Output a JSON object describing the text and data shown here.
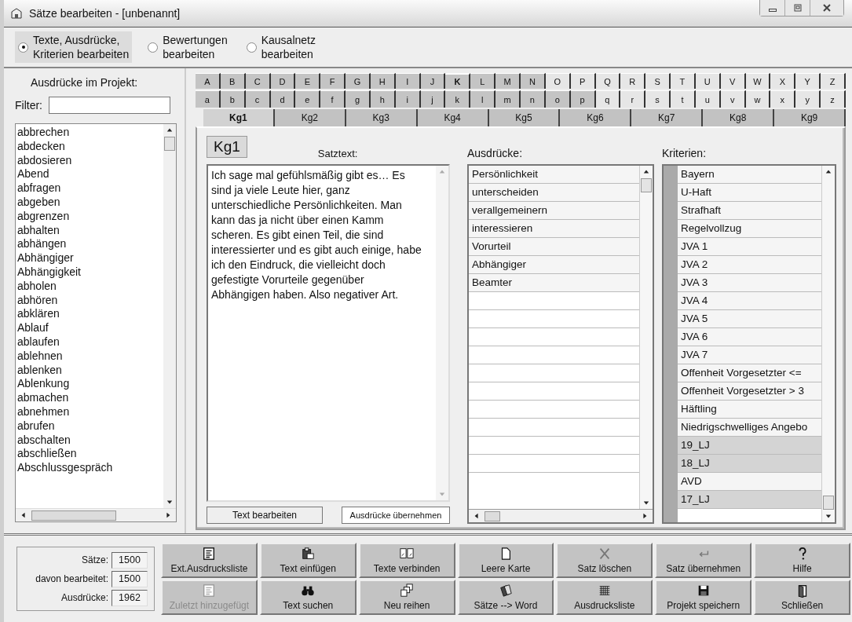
{
  "window": {
    "title": "Sätze bearbeiten - [unbenannt]"
  },
  "modes": [
    {
      "label": "Texte, Ausdrücke,\nKriterien bearbeiten",
      "selected": true
    },
    {
      "label": "Bewertungen\nbearbeiten",
      "selected": false
    },
    {
      "label": "Kausalnetz\nbearbeiten",
      "selected": false
    }
  ],
  "expressions_panel": {
    "title": "Ausdrücke im Projekt:",
    "filter_label": "Filter:",
    "items": [
      "abbrechen",
      "abdecken",
      "abdosieren",
      "Abend",
      "abfragen",
      "abgeben",
      "abgrenzen",
      "abhalten",
      "abhängen",
      "Abhängiger",
      "Abhängigkeit",
      "abholen",
      "abhören",
      "abklären",
      "Ablauf",
      "ablaufen",
      "ablehnen",
      "ablenken",
      "Ablenkung",
      "abmachen",
      "abnehmen",
      "abrufen",
      "abschalten",
      "abschließen",
      "Abschlussgespräch"
    ]
  },
  "letters_upper": [
    {
      "label": "A",
      "selected": false,
      "shaded": true
    },
    {
      "label": "B",
      "selected": false,
      "shaded": true
    },
    {
      "label": "C",
      "selected": false,
      "shaded": true
    },
    {
      "label": "D",
      "selected": false,
      "shaded": true
    },
    {
      "label": "E",
      "selected": false,
      "shaded": true
    },
    {
      "label": "F",
      "selected": false,
      "shaded": true
    },
    {
      "label": "G",
      "selected": false,
      "shaded": true
    },
    {
      "label": "H",
      "selected": false,
      "shaded": true
    },
    {
      "label": "I",
      "selected": false,
      "shaded": true
    },
    {
      "label": "J",
      "selected": false,
      "shaded": true
    },
    {
      "label": "K",
      "selected": true,
      "shaded": true
    },
    {
      "label": "L",
      "selected": false,
      "shaded": true
    },
    {
      "label": "M",
      "selected": false,
      "shaded": true
    },
    {
      "label": "N",
      "selected": false,
      "shaded": true
    },
    {
      "label": "O",
      "selected": false,
      "shaded": false
    },
    {
      "label": "P",
      "selected": false,
      "shaded": false
    },
    {
      "label": "Q",
      "selected": false,
      "shaded": false
    },
    {
      "label": "R",
      "selected": false,
      "shaded": false
    },
    {
      "label": "S",
      "selected": false,
      "shaded": false
    },
    {
      "label": "T",
      "selected": false,
      "shaded": false
    },
    {
      "label": "U",
      "selected": false,
      "shaded": false
    },
    {
      "label": "V",
      "selected": false,
      "shaded": false
    },
    {
      "label": "W",
      "selected": false,
      "shaded": false
    },
    {
      "label": "X",
      "selected": false,
      "shaded": false
    },
    {
      "label": "Y",
      "selected": false,
      "shaded": false
    },
    {
      "label": "Z",
      "selected": false,
      "shaded": false
    }
  ],
  "letters_lower": [
    {
      "label": "a",
      "selected": false,
      "shaded": true
    },
    {
      "label": "b",
      "selected": false,
      "shaded": true
    },
    {
      "label": "c",
      "selected": false,
      "shaded": true
    },
    {
      "label": "d",
      "selected": false,
      "shaded": true
    },
    {
      "label": "e",
      "selected": false,
      "shaded": true
    },
    {
      "label": "f",
      "selected": false,
      "shaded": true
    },
    {
      "label": "g",
      "selected": false,
      "shaded": true
    },
    {
      "label": "h",
      "selected": false,
      "shaded": true
    },
    {
      "label": "i",
      "selected": false,
      "shaded": true
    },
    {
      "label": "j",
      "selected": false,
      "shaded": true
    },
    {
      "label": "k",
      "selected": false,
      "shaded": true
    },
    {
      "label": "l",
      "selected": false,
      "shaded": true
    },
    {
      "label": "m",
      "selected": false,
      "shaded": true
    },
    {
      "label": "n",
      "selected": false,
      "shaded": true
    },
    {
      "label": "o",
      "selected": false,
      "shaded": true
    },
    {
      "label": "p",
      "selected": false,
      "shaded": true
    },
    {
      "label": "q",
      "selected": false,
      "shaded": false
    },
    {
      "label": "r",
      "selected": false,
      "shaded": false
    },
    {
      "label": "s",
      "selected": false,
      "shaded": false
    },
    {
      "label": "t",
      "selected": false,
      "shaded": false
    },
    {
      "label": "u",
      "selected": false,
      "shaded": false
    },
    {
      "label": "v",
      "selected": false,
      "shaded": false
    },
    {
      "label": "w",
      "selected": false,
      "shaded": false
    },
    {
      "label": "x",
      "selected": false,
      "shaded": false
    },
    {
      "label": "y",
      "selected": false,
      "shaded": false
    },
    {
      "label": "z",
      "selected": false,
      "shaded": false
    }
  ],
  "card_tabs": [
    {
      "label": "Kg1",
      "selected": true
    },
    {
      "label": "Kg2",
      "selected": false
    },
    {
      "label": "Kg3",
      "selected": false
    },
    {
      "label": "Kg4",
      "selected": false
    },
    {
      "label": "Kg5",
      "selected": false
    },
    {
      "label": "Kg6",
      "selected": false
    },
    {
      "label": "Kg7",
      "selected": false
    },
    {
      "label": "Kg8",
      "selected": false
    },
    {
      "label": "Kg9",
      "selected": false
    }
  ],
  "card": {
    "badge": "Kg1",
    "text_label": "Satztext:",
    "text": "Ich sage mal gefühlsmäßig gibt es… Es sind ja viele Leute hier, ganz unterschiedliche Persönlichkeiten. Man kann das ja nicht über einen Kamm scheren. Es gibt einen Teil, die sind interessierter und es gibt auch einige, habe ich den Eindruck, die vielleicht doch gefestigte Vorurteile gegenüber Abhängigen haben. Also negativer Art.",
    "text_buttons": [
      "Text bearbeiten",
      "Ausdrücke übernehmen"
    ],
    "expressions_label": "Ausdrücke:",
    "expressions": [
      "Persönlichkeit",
      "unterscheiden",
      "verallgemeinern",
      "interessieren",
      "Vorurteil",
      "Abhängiger",
      "Beamter"
    ],
    "criteria_label": "Kriterien:",
    "criteria": [
      {
        "label": "Bayern",
        "shaded": false
      },
      {
        "label": "U-Haft",
        "shaded": false
      },
      {
        "label": "Strafhaft",
        "shaded": false
      },
      {
        "label": "Regelvollzug",
        "shaded": false
      },
      {
        "label": "JVA 1",
        "shaded": false
      },
      {
        "label": "JVA 2",
        "shaded": false
      },
      {
        "label": "JVA 3",
        "shaded": false
      },
      {
        "label": "JVA 4",
        "shaded": false
      },
      {
        "label": "JVA 5",
        "shaded": false
      },
      {
        "label": "JVA 6",
        "shaded": false
      },
      {
        "label": "JVA 7",
        "shaded": false
      },
      {
        "label": "Offenheit Vorgesetzter <=",
        "shaded": false
      },
      {
        "label": "Offenheit Vorgesetzter > 3",
        "shaded": false
      },
      {
        "label": "Häftling",
        "shaded": false
      },
      {
        "label": "Niedrigschwelliges Angebo",
        "shaded": false
      },
      {
        "label": "19_LJ",
        "shaded": true
      },
      {
        "label": "18_LJ",
        "shaded": true
      },
      {
        "label": "AVD",
        "shaded": false
      },
      {
        "label": "17_LJ",
        "shaded": true
      }
    ]
  },
  "stats": [
    {
      "label": "Sätze:",
      "value": "1500"
    },
    {
      "label": "davon bearbeitet:",
      "value": "1500"
    },
    {
      "label": "Ausdrücke:",
      "value": "1962"
    }
  ],
  "buttons": [
    {
      "label": "Ext.Ausdrucksliste",
      "disabled": false
    },
    {
      "label": "Text einfügen",
      "disabled": false
    },
    {
      "label": "Texte verbinden",
      "disabled": false
    },
    {
      "label": "Leere Karte",
      "disabled": false
    },
    {
      "label": "Satz löschen",
      "disabled": false
    },
    {
      "label": "Satz übernehmen",
      "disabled": false
    },
    {
      "label": "Hilfe",
      "disabled": false
    },
    {
      "label": "Zuletzt hinzugefügt",
      "disabled": true
    },
    {
      "label": "Text suchen",
      "disabled": false
    },
    {
      "label": "Neu reihen",
      "disabled": false
    },
    {
      "label": "Sätze --> Word",
      "disabled": false
    },
    {
      "label": "Ausdrucksliste",
      "disabled": false
    },
    {
      "label": "Projekt speichern",
      "disabled": false
    },
    {
      "label": "Schließen",
      "disabled": false
    }
  ]
}
